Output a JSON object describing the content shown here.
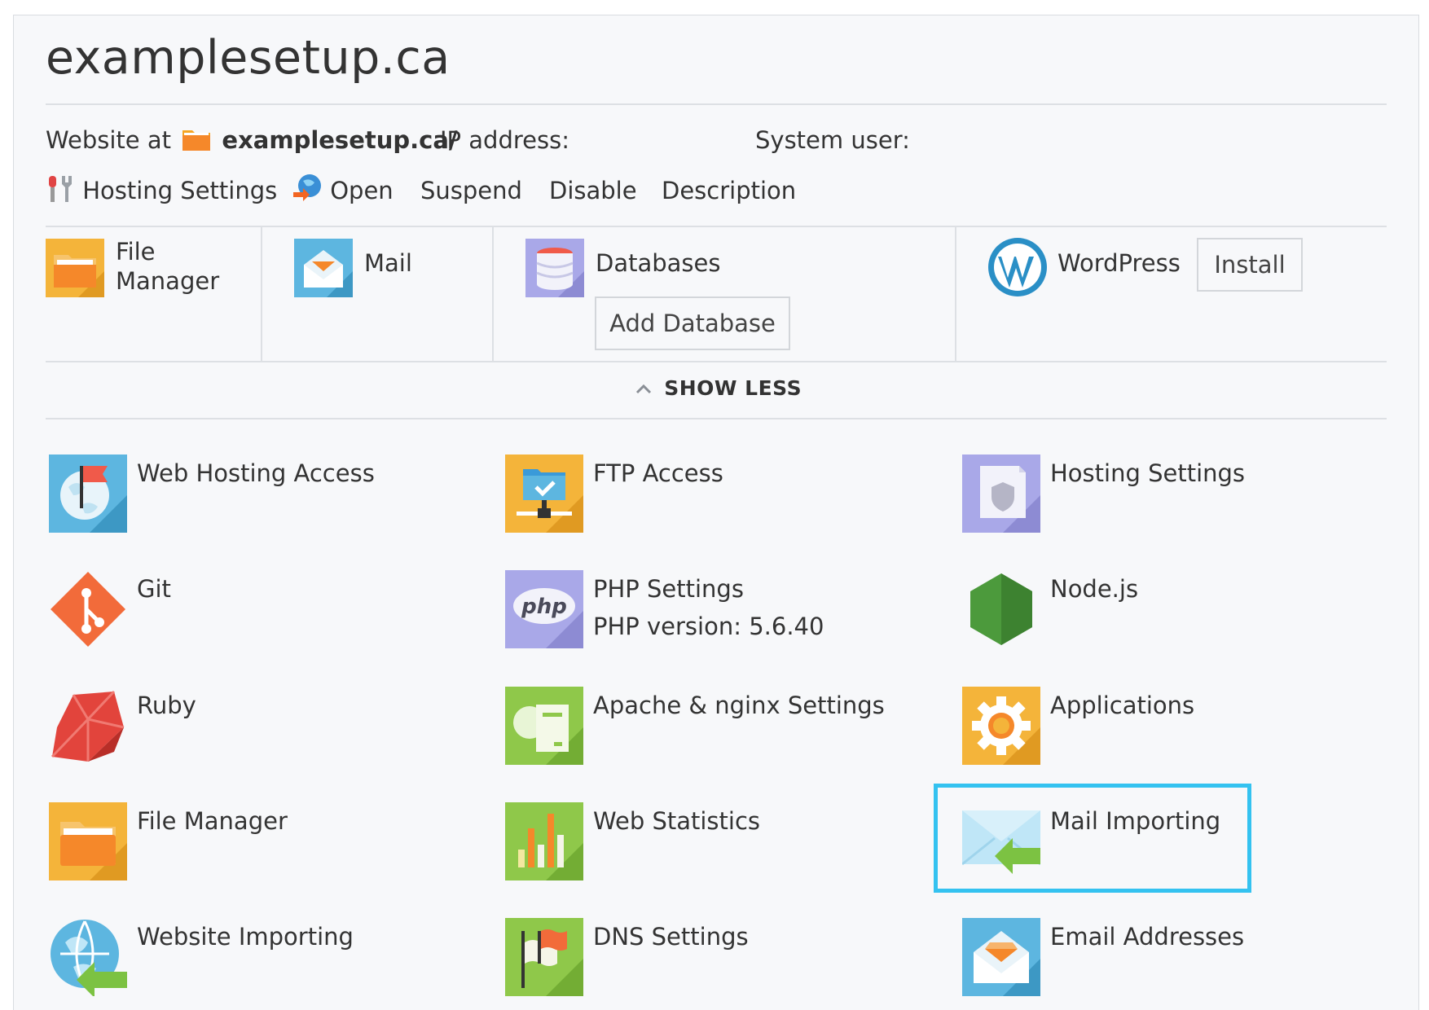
{
  "domain_title": "examplesetup.ca",
  "info": {
    "website_at_label": "Website at",
    "website_path": "examplesetup.ca/",
    "ip_label": "IP address:",
    "system_user_label": "System user:"
  },
  "actions": [
    {
      "label": "Hosting Settings",
      "icon": "tools-icon"
    },
    {
      "label": "Open",
      "icon": "globe-arrow-icon"
    },
    {
      "label": "Suspend"
    },
    {
      "label": "Disable"
    },
    {
      "label": "Description"
    }
  ],
  "quick": {
    "file_manager": "File Manager",
    "file_manager_l1": "File",
    "file_manager_l2": "Manager",
    "mail": "Mail",
    "databases": "Databases",
    "add_database": "Add Database",
    "wordpress": "WordPress",
    "install": "Install"
  },
  "show_less": "SHOW LESS",
  "tools": [
    {
      "label": "Web Hosting Access",
      "icon": "globe-flag-icon"
    },
    {
      "label": "FTP Access",
      "icon": "ftp-folder-icon"
    },
    {
      "label": "Hosting Settings",
      "icon": "hosting-settings-icon"
    },
    {
      "label": "Git",
      "icon": "git-icon"
    },
    {
      "label": "PHP Settings",
      "sub": "PHP version: 5.6.40",
      "icon": "php-icon"
    },
    {
      "label": "Node.js",
      "icon": "nodejs-icon"
    },
    {
      "label": "Ruby",
      "icon": "ruby-icon"
    },
    {
      "label": "Apache & nginx Settings",
      "icon": "apache-nginx-icon"
    },
    {
      "label": "Applications",
      "icon": "gear-icon"
    },
    {
      "label": "File Manager",
      "icon": "folder-icon"
    },
    {
      "label": "Web Statistics",
      "icon": "bar-chart-icon"
    },
    {
      "label": "Mail Importing",
      "icon": "mail-import-icon"
    },
    {
      "label": "Website Importing",
      "icon": "globe-import-icon"
    },
    {
      "label": "DNS Settings",
      "icon": "dns-flag-icon"
    },
    {
      "label": "Email Addresses",
      "icon": "email-icon"
    }
  ],
  "colors": {
    "highlight": "#34c2f0",
    "folder": "#f5882a",
    "tile_yellow": "#f4b43a",
    "tile_blue": "#5db6e0",
    "tile_purple": "#a9a8e8",
    "tile_green": "#8fc84a"
  }
}
